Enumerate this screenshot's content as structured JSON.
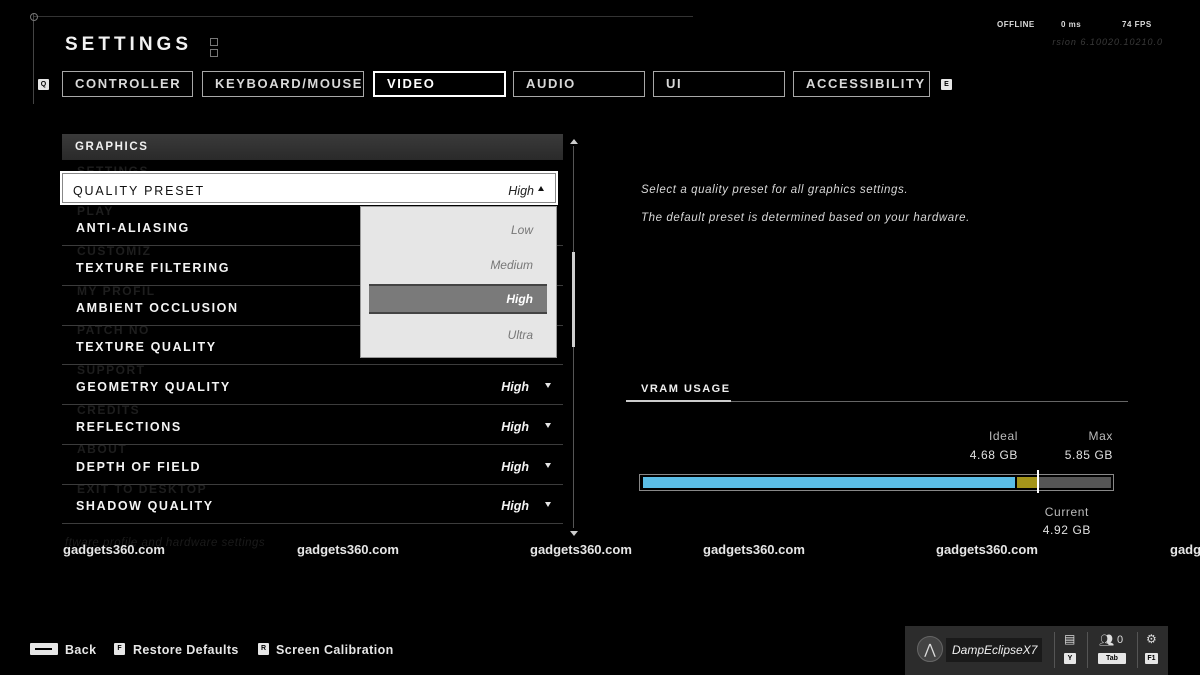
{
  "header": {
    "title": "SETTINGS"
  },
  "status": {
    "network": "OFFLINE",
    "ping": "0 ms",
    "fps": "74 FPS",
    "version": "rsion 6.10020.10210.0"
  },
  "tabs": {
    "left_key": "Q",
    "right_key": "E",
    "items": [
      {
        "label": "CONTROLLER"
      },
      {
        "label": "KEYBOARD/MOUSE"
      },
      {
        "label": "VIDEO"
      },
      {
        "label": "AUDIO"
      },
      {
        "label": "UI"
      },
      {
        "label": "ACCESSIBILITY"
      }
    ],
    "active": "VIDEO"
  },
  "section": {
    "header": "GRAPHICS"
  },
  "settings": [
    {
      "label": "QUALITY PRESET",
      "value": "High"
    },
    {
      "label": "ANTI-ALIASING",
      "value": ""
    },
    {
      "label": "TEXTURE FILTERING",
      "value": ""
    },
    {
      "label": "AMBIENT OCCLUSION",
      "value": ""
    },
    {
      "label": "TEXTURE QUALITY",
      "value": ""
    },
    {
      "label": "GEOMETRY QUALITY",
      "value": "High"
    },
    {
      "label": "REFLECTIONS",
      "value": "High"
    },
    {
      "label": "DEPTH OF FIELD",
      "value": "High"
    },
    {
      "label": "SHADOW QUALITY",
      "value": "High"
    }
  ],
  "ghost_menu": [
    "SETTINGS",
    "PLAY",
    "CUSTOMIZ",
    "MY PROFIL",
    "PATCH NO",
    "SUPPORT",
    "CREDITS",
    "ABOUT",
    "EXIT TO DESKTOP"
  ],
  "dropdown": {
    "options": [
      "Low",
      "Medium",
      "High",
      "Ultra"
    ],
    "selected": "High"
  },
  "description": {
    "line1": "Select a quality preset for all graphics settings.",
    "line2": "The default preset is determined based on your hardware."
  },
  "vram": {
    "title": "VRAM USAGE",
    "ideal_label": "Ideal",
    "ideal_value": "4.68 GB",
    "max_label": "Max",
    "max_value": "5.85 GB",
    "current_label": "Current",
    "current_value": "4.92 GB",
    "ideal_gb": 4.68,
    "current_gb": 4.92,
    "max_gb": 5.85,
    "colors": {
      "ideal": "#5bbde6",
      "over": "#a4941a",
      "remaining": "#555555"
    }
  },
  "watermark": {
    "text": "gadgets360.com",
    "partial": "gadgets360.com",
    "hidden_line": "ftware profile and hardware settings"
  },
  "footer": {
    "back_label": "Back",
    "restore_key": "F",
    "restore_label": "Restore Defaults",
    "calibration_key": "R",
    "calibration_label": "Screen Calibration"
  },
  "profile": {
    "gamertag": "DampEclipseX7",
    "chat_key": "Y",
    "friends_count": "0",
    "friends_key": "Tab",
    "settings_key": "F1"
  }
}
